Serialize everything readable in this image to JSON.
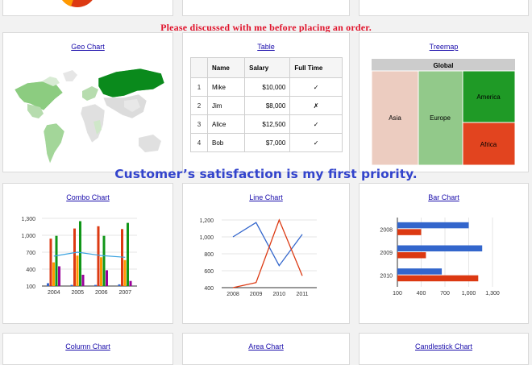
{
  "banners": {
    "top": "Please discussed with me before placing an order.",
    "middle": "Customer’s satisfaction is my first priority."
  },
  "cards": {
    "geo": "Geo Chart",
    "table": "Table",
    "treemap": "Treemap",
    "combo": "Combo Chart",
    "line": "Line Chart",
    "bar": "Bar Chart",
    "column": "Column Chart",
    "area": "Area Chart",
    "candlestick": "Candlestick Chart"
  },
  "table": {
    "headers": [
      "",
      "Name",
      "Salary",
      "Full Time"
    ],
    "rows": [
      {
        "idx": "1",
        "name": "Mike",
        "salary": "$10,000",
        "full_time": "✓"
      },
      {
        "idx": "2",
        "name": "Jim",
        "salary": "$8,000",
        "full_time": "✗"
      },
      {
        "idx": "3",
        "name": "Alice",
        "salary": "$12,500",
        "full_time": "✓"
      },
      {
        "idx": "4",
        "name": "Bob",
        "salary": "$7,000",
        "full_time": "✓"
      }
    ]
  },
  "treemap": {
    "root": "Global",
    "nodes": [
      {
        "label": "Asia",
        "color": "#ecccc0"
      },
      {
        "label": "Europe",
        "color": "#92c98a"
      },
      {
        "label": "America",
        "color": "#1f9a26"
      },
      {
        "label": "Africa",
        "color": "#e2441f"
      }
    ]
  },
  "chart_data": [
    {
      "type": "bar",
      "subtype": "combo",
      "categories": [
        "2004",
        "2005",
        "2006",
        "2007"
      ],
      "yticks": [
        "1,300",
        "1,000",
        "700",
        "400",
        "100"
      ],
      "ylim": [
        100,
        1300
      ],
      "series": [
        {
          "color": "#3366cc",
          "values": [
            150,
            120,
            120,
            130
          ]
        },
        {
          "color": "#dc3912",
          "values": [
            940,
            1120,
            1160,
            1110
          ]
        },
        {
          "color": "#ff9900",
          "values": [
            520,
            640,
            610,
            560
          ]
        },
        {
          "color": "#109618",
          "values": [
            990,
            1250,
            990,
            1220
          ]
        },
        {
          "color": "#990099",
          "values": [
            450,
            300,
            380,
            190
          ]
        }
      ],
      "line": {
        "color": "#3ba3e0",
        "values": [
          630,
          700,
          640,
          610
        ]
      },
      "colors": {
        "grid": "#e6e6e6",
        "axis": "#333333"
      }
    },
    {
      "type": "line",
      "x": [
        "2008",
        "2009",
        "2010",
        "2011"
      ],
      "yticks": [
        "1,200",
        "1,000",
        "800",
        "600",
        "400"
      ],
      "ylim": [
        400,
        1200
      ],
      "series": [
        {
          "color": "#3366cc",
          "values": [
            1000,
            1170,
            660,
            1030
          ]
        },
        {
          "color": "#dc3912",
          "values": [
            400,
            460,
            1200,
            540
          ]
        }
      ]
    },
    {
      "type": "bar",
      "orientation": "horizontal",
      "categories": [
        "2008",
        "2009",
        "2010"
      ],
      "xticks": [
        "100",
        "400",
        "700",
        "1,000",
        "1,300"
      ],
      "xlim": [
        100,
        1300
      ],
      "series": [
        {
          "color": "#3366cc",
          "values": [
            1000,
            1170,
            660
          ]
        },
        {
          "color": "#dc3912",
          "values": [
            400,
            460,
            1120
          ]
        }
      ]
    }
  ]
}
